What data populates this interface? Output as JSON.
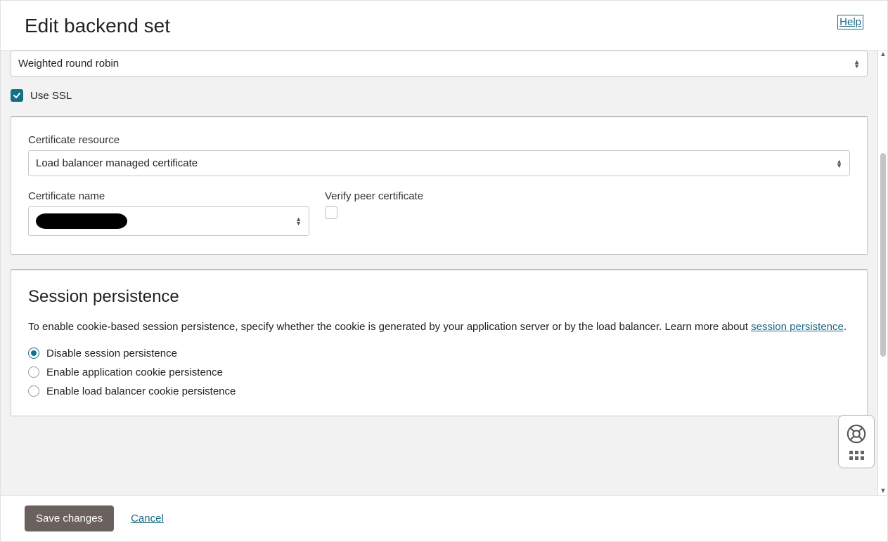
{
  "header": {
    "title": "Edit backend set",
    "help_label": "Help"
  },
  "policy_select": {
    "value": "Weighted round robin"
  },
  "use_ssl": {
    "label": "Use SSL",
    "checked": true
  },
  "cert_panel": {
    "resource_label": "Certificate resource",
    "resource_value": "Load balancer managed certificate",
    "name_label": "Certificate name",
    "name_value": "",
    "verify_label": "Verify peer certificate",
    "verify_checked": false
  },
  "session_panel": {
    "heading": "Session persistence",
    "desc_pre": "To enable cookie-based session persistence, specify whether the cookie is generated by your application server or by the load balancer. Learn more about ",
    "desc_link": "session persistence",
    "desc_post": ".",
    "options": [
      {
        "label": "Disable session persistence",
        "selected": true
      },
      {
        "label": "Enable application cookie persistence",
        "selected": false
      },
      {
        "label": "Enable load balancer cookie persistence",
        "selected": false
      }
    ]
  },
  "footer": {
    "save_label": "Save changes",
    "cancel_label": "Cancel"
  }
}
